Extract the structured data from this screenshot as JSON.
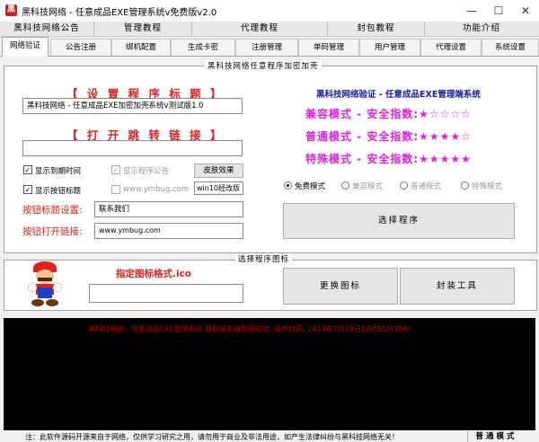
{
  "window": {
    "title": "黑科技网络 - 任意成品EXE管理系统v免费版v2.0",
    "app_icon": "黑"
  },
  "menu": [
    "黑科技网络公告",
    "管理教程",
    "代理教程",
    "封包教程",
    "功能介绍"
  ],
  "tabs": [
    "网络验证",
    "公告注册",
    "绑机配置",
    "生成卡密",
    "注册管理",
    "单码管理",
    "用户管理",
    "代理设置",
    "系统设置"
  ],
  "encrypt": {
    "legend": "黑科技网络任意程序加密加壳",
    "set_title_heading": "【 设 置 程 序 标 题 】",
    "title_value": "黑科技网络 - 任意成品EXE加密加壳系统v测试版1.0",
    "open_link_heading": "【 打 开 跳 转 链 接 】",
    "link_value": "",
    "checks": {
      "show_expire": "显示到期时间",
      "show_buttons": "显示按钮标题",
      "show_notice": "显示程序公告",
      "watermark": "www.ymbug.com"
    },
    "skin_button": "皮肤效果",
    "skin_value": "win10经改版",
    "btn_title_label": "按钮标题设置:",
    "btn_title_value": "联系我们",
    "btn_link_label": "按钮打开链接:",
    "btn_link_value": "www.ymbug.com",
    "verify_title": "黑科技网络验证 - 任意成品EXE管理端系统",
    "modes": [
      {
        "label": "兼容模式 - 安全指数:",
        "stars": "★☆☆☆☆"
      },
      {
        "label": "普通模式 - 安全指数:",
        "stars": "★★★★☆"
      },
      {
        "label": "特殊模式 - 安全指数:",
        "stars": "★★★★★"
      }
    ],
    "radios": [
      "免费模式",
      "兼容模式",
      "普通模式",
      "特殊模式"
    ],
    "select_program_button": "选择程序"
  },
  "icon_section": {
    "legend": "选择程序图标",
    "format_text": "指定图标格式.ico",
    "icon_path_value": "",
    "change_icon_button": "更换图标",
    "pack_tool_button": "封装工具"
  },
  "log": {
    "line": "黑科技网络 - 任意成品EXE管理系统 获取服务器数据成功, 操作时间: 2019年7月18日16时55分35秒"
  },
  "status": {
    "notice": "注：此软件源码开源来自于网络，仅供学习研究之用，请勿用于商业及非法用途，如产生法律纠纷与黑科技网络无关！",
    "mode": "普 通 模 式"
  },
  "colors": {
    "accent_red": "#e02020",
    "mode_magenta": "#e020e0",
    "verify_blue": "#1a1aa6"
  }
}
